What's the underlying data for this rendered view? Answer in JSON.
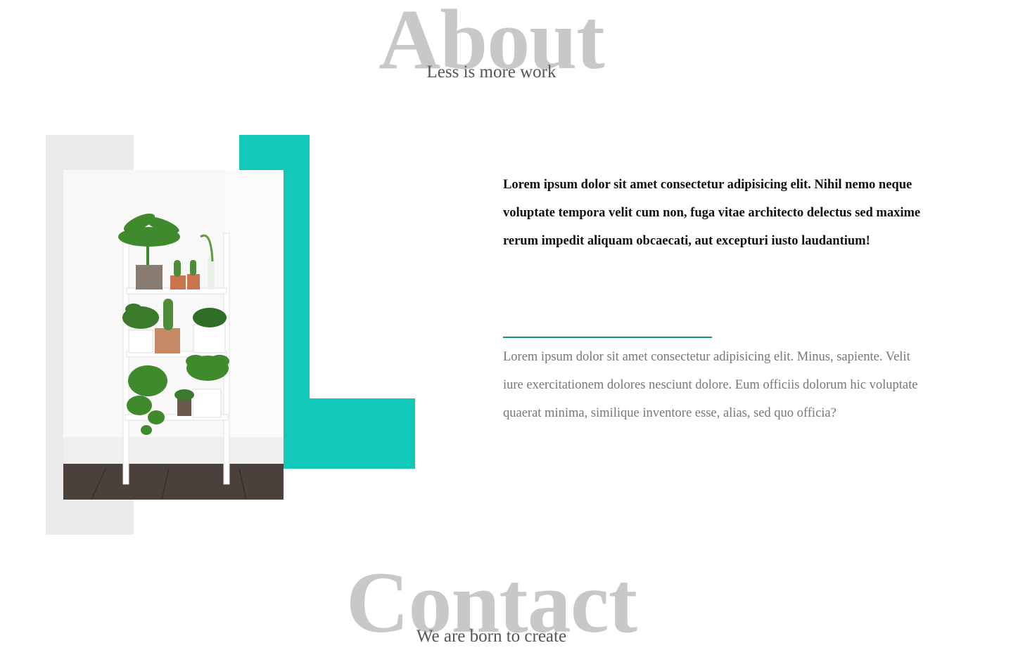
{
  "about": {
    "title": "About",
    "subtitle": "Less is more work",
    "lead": "Lorem ipsum dolor sit amet consectetur adipisicing elit. Nihil nemo neque voluptate tempora velit cum non, fuga vitae architecto delectus sed maxime rerum impedit aliquam obcaecati, aut excepturi iusto laudantium!",
    "body": "Lorem ipsum dolor sit amet consectetur adipisicing elit. Minus, sapiente. Velit iure exercitationem dolores nesciunt dolore. Eum officiis dolorum hic voluptate quaerat minima, similique inventore esse, alias, sed quo officia?",
    "image_icon": "plant-ladder-photo"
  },
  "contact": {
    "title": "Contact",
    "subtitle": "We are born to create"
  },
  "colors": {
    "accent": "#10c9b8",
    "divider": "#0f8f85",
    "title_grey": "#c8c8c8",
    "panel_grey": "#ebebeb"
  }
}
